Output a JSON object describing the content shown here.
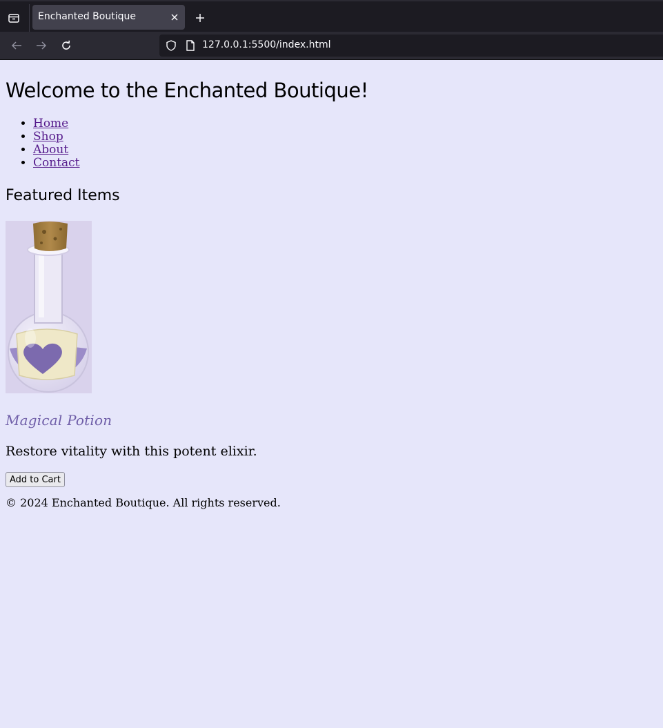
{
  "browser": {
    "tab_title": "Enchanted Boutique",
    "url": "127.0.0.1:5500/index.html"
  },
  "page": {
    "title": "Welcome to the Enchanted Boutique!",
    "nav": [
      {
        "label": "Home"
      },
      {
        "label": "Shop"
      },
      {
        "label": "About"
      },
      {
        "label": "Contact"
      }
    ],
    "featured_heading": "Featured Items",
    "product": {
      "name": "Magical Potion",
      "description": "Restore vitality with this potent elixir.",
      "button_label": "Add to Cart",
      "image_icon": "potion-bottle-heart"
    },
    "footer": "© 2024 Enchanted Boutique. All rights reserved."
  },
  "colors": {
    "page_background": "#e6e6fa",
    "link": "#551a8b",
    "product_name": "#6f5ea8"
  }
}
